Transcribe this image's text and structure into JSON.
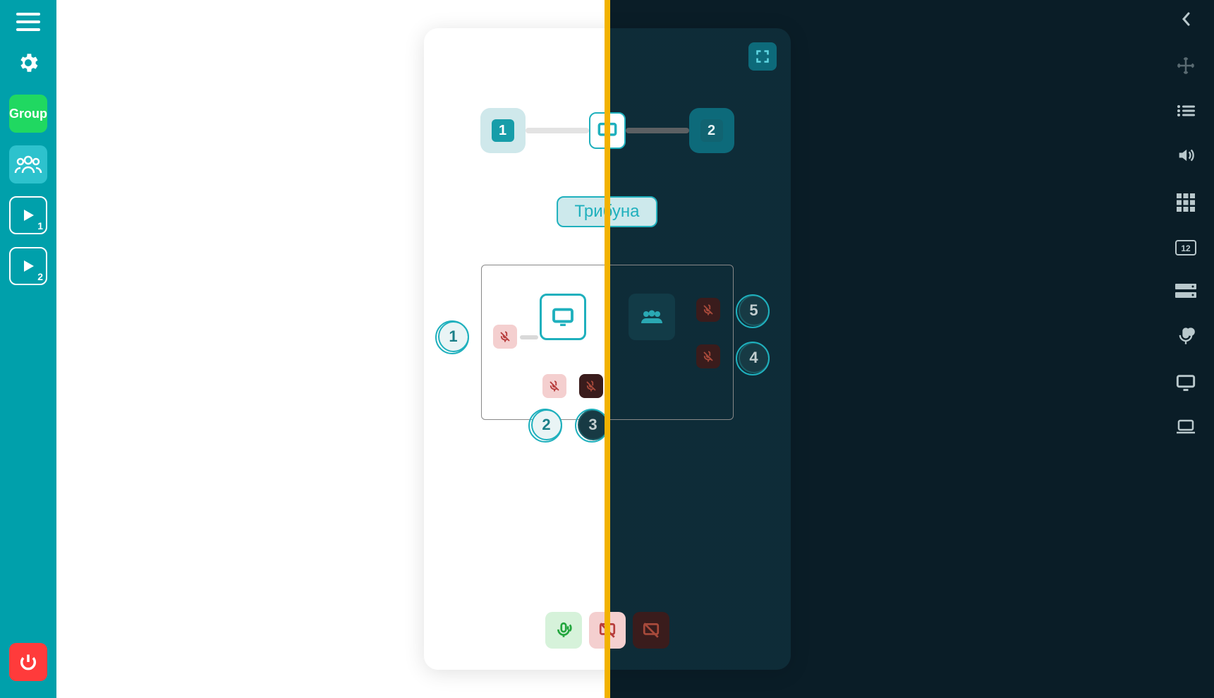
{
  "left_sidebar": {
    "group_label": "Group",
    "play1_sub": "1",
    "play2_sub": "2"
  },
  "canvas": {
    "monitor_left_num": "1",
    "monitor_right_num": "2",
    "tribune_label": "Трибуна",
    "seats": {
      "s1": "1",
      "s2": "2",
      "s3": "3",
      "s4": "4",
      "s5": "5"
    }
  },
  "right_sidebar": {}
}
